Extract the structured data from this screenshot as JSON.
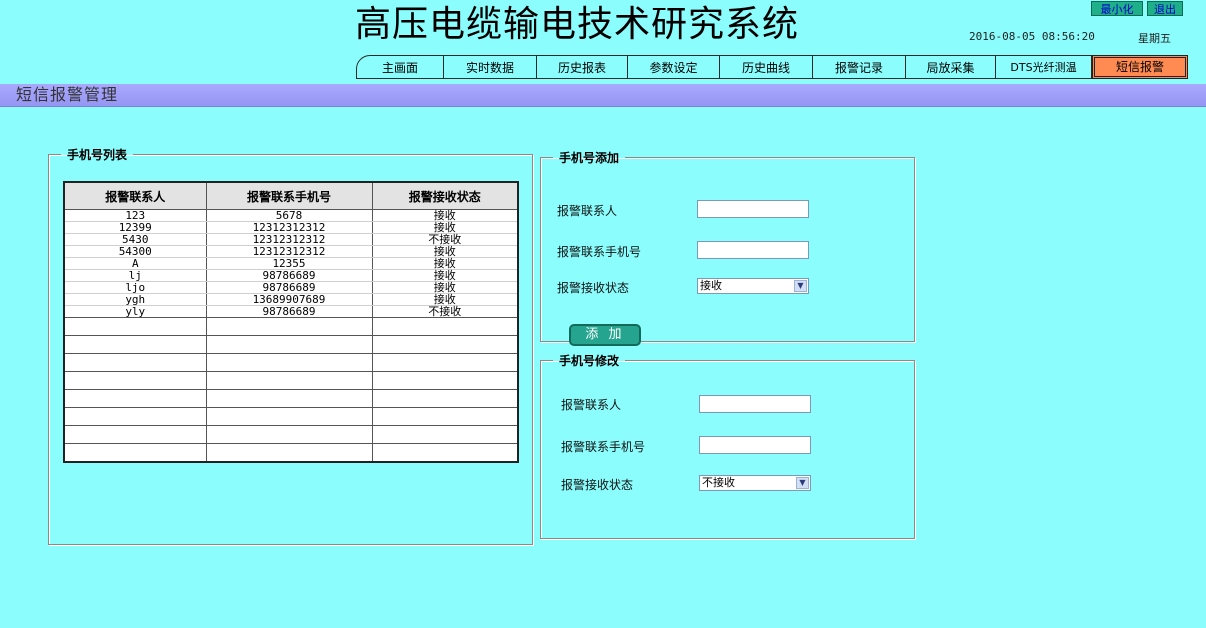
{
  "app": {
    "title": "高压电缆输电技术研究系统",
    "minimize_label": "最小化",
    "exit_label": "退出",
    "datetime": "2016-08-05 08:56:20",
    "weekday": "星期五"
  },
  "nav": {
    "tabs": [
      {
        "label": "主画面"
      },
      {
        "label": "实时数据"
      },
      {
        "label": "历史报表"
      },
      {
        "label": "参数设定"
      },
      {
        "label": "历史曲线"
      },
      {
        "label": "报警记录"
      },
      {
        "label": "局放采集"
      },
      {
        "label": "DTS光纤测温"
      },
      {
        "label": "短信报警"
      }
    ],
    "active": "短信报警"
  },
  "page": {
    "title": "短信报警管理"
  },
  "phone_list": {
    "legend": "手机号列表",
    "columns": [
      "报警联系人",
      "报警联系手机号",
      "报警接收状态"
    ],
    "rows": [
      [
        "123",
        "5678",
        "接收"
      ],
      [
        "12399",
        "12312312312",
        "接收"
      ],
      [
        "5430",
        "12312312312",
        "不接收"
      ],
      [
        "54300",
        "12312312312",
        "接收"
      ],
      [
        "A",
        "12355",
        "接收"
      ],
      [
        "lj",
        "98786689",
        "接收"
      ],
      [
        "ljo",
        "98786689",
        "接收"
      ],
      [
        "ygh",
        "13689907689",
        "接收"
      ],
      [
        "yly",
        "98786689",
        "不接收"
      ]
    ]
  },
  "add_form": {
    "legend": "手机号添加",
    "contact_label": "报警联系人",
    "contact_value": "",
    "phone_label": "报警联系手机号",
    "phone_value": "",
    "status_label": "报警接收状态",
    "status_value": "接收",
    "button_label": "添 加"
  },
  "edit_form": {
    "legend": "手机号修改",
    "contact_label": "报警联系人",
    "contact_value": "",
    "phone_label": "报警联系手机号",
    "phone_value": "",
    "status_label": "报警接收状态",
    "status_value": "不接收"
  },
  "colors": {
    "background": "#8cfdfd",
    "header_bar": "#9f9ffa",
    "active_tab": "#ff8b52",
    "window_button": "#1fb08a",
    "add_button": "#25a58f"
  }
}
